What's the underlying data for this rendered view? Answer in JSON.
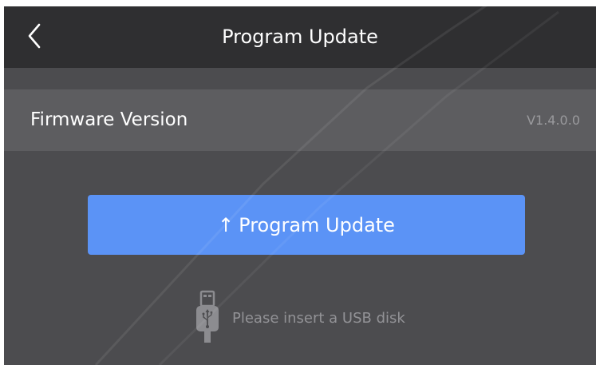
{
  "header": {
    "title": "Program Update",
    "back_icon": "chevron-left-icon"
  },
  "firmware": {
    "label": "Firmware Version",
    "value": "V1.4.0.0"
  },
  "update_button": {
    "icon": "arrow-up-icon",
    "arrow_glyph": "↑",
    "label": "Program Update"
  },
  "usb_hint": {
    "icon": "usb-drive-icon",
    "text": "Please insert a USB disk"
  },
  "colors": {
    "accent": "#5b93f6",
    "header_bg": "#2f2f31",
    "body_bg": "#4c4c4f",
    "row_bg": "#5d5d60"
  }
}
